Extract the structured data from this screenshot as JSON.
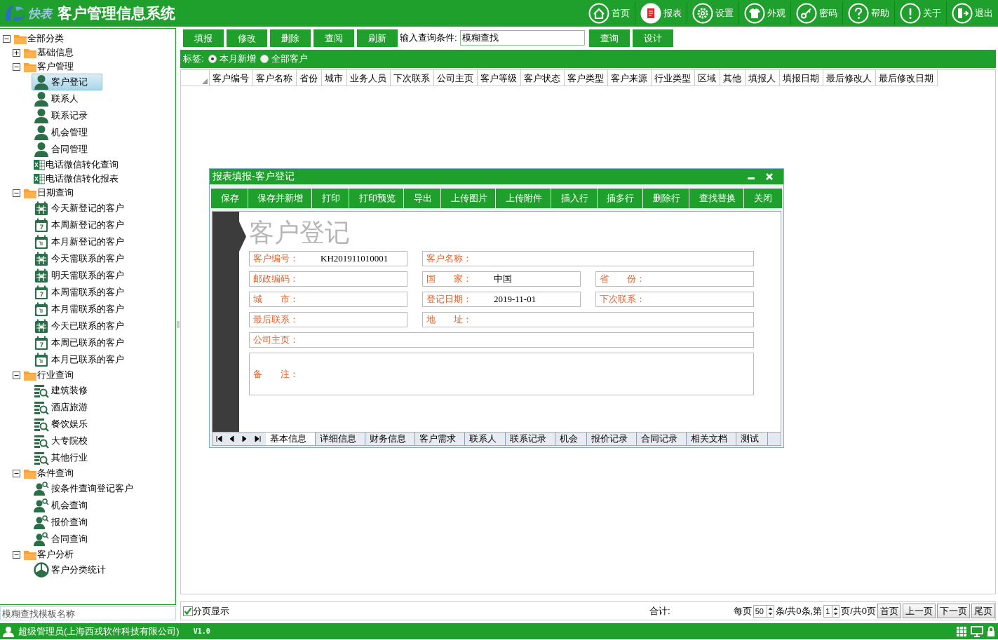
{
  "app": {
    "logo_text": "快表",
    "title": "客户管理信息系统"
  },
  "nav": [
    {
      "label": "首页",
      "selected": false
    },
    {
      "label": "报表",
      "selected": true
    },
    {
      "label": "设置",
      "selected": false
    },
    {
      "label": "外观",
      "selected": false
    },
    {
      "label": "密码",
      "selected": false
    },
    {
      "label": "帮助",
      "selected": false
    },
    {
      "label": "关于",
      "selected": false
    },
    {
      "label": "退出",
      "selected": false
    }
  ],
  "tree": [
    {
      "label": "全部分类",
      "kind": "folder",
      "expanded": true,
      "selected": false,
      "children": [
        {
          "label": "基础信息",
          "kind": "folder",
          "expanded": false,
          "selected": false
        },
        {
          "label": "客户管理",
          "kind": "folder",
          "expanded": true,
          "selected": false,
          "children": [
            {
              "label": "客户登记",
              "kind": "person",
              "selected": true
            },
            {
              "label": "联系人",
              "kind": "person",
              "selected": false
            },
            {
              "label": "联系记录",
              "kind": "person",
              "selected": false
            },
            {
              "label": "机会管理",
              "kind": "person",
              "selected": false
            },
            {
              "label": "合同管理",
              "kind": "person",
              "selected": false
            },
            {
              "label": "电话微信转化查询",
              "kind": "sheet",
              "selected": false
            },
            {
              "label": "电话微信转化报表",
              "kind": "sheet",
              "selected": false
            }
          ]
        },
        {
          "label": "日期查询",
          "kind": "folder",
          "expanded": true,
          "selected": false,
          "children": [
            {
              "label": "今天新登记的客户",
              "kind": "day",
              "selected": false
            },
            {
              "label": "本周新登记的客户",
              "kind": "week",
              "selected": false
            },
            {
              "label": "本月新登记的客户",
              "kind": "month",
              "selected": false
            },
            {
              "label": "今天需联系的客户",
              "kind": "day",
              "selected": false
            },
            {
              "label": "明天需联系的客户",
              "kind": "day",
              "selected": false
            },
            {
              "label": "本周需联系的客户",
              "kind": "week",
              "selected": false
            },
            {
              "label": "本月需联系的客户",
              "kind": "month",
              "selected": false
            },
            {
              "label": "今天已联系的客户",
              "kind": "day",
              "selected": false
            },
            {
              "label": "本周已联系的客户",
              "kind": "week",
              "selected": false
            },
            {
              "label": "本月已联系的客户",
              "kind": "month",
              "selected": false
            }
          ]
        },
        {
          "label": "行业查询",
          "kind": "folder",
          "expanded": true,
          "selected": false,
          "children": [
            {
              "label": "建筑装修",
              "kind": "industry",
              "selected": false
            },
            {
              "label": "酒店旅游",
              "kind": "industry",
              "selected": false
            },
            {
              "label": "餐饮娱乐",
              "kind": "industry",
              "selected": false
            },
            {
              "label": "大专院校",
              "kind": "industry",
              "selected": false
            },
            {
              "label": "其他行业",
              "kind": "industry",
              "selected": false
            }
          ]
        },
        {
          "label": "条件查询",
          "kind": "folder",
          "expanded": true,
          "selected": false,
          "children": [
            {
              "label": "按条件查询登记客户",
              "kind": "query",
              "selected": false
            },
            {
              "label": "机会查询",
              "kind": "query",
              "selected": false
            },
            {
              "label": "报价查询",
              "kind": "query",
              "selected": false
            },
            {
              "label": "合同查询",
              "kind": "query",
              "selected": false
            }
          ]
        },
        {
          "label": "客户分析",
          "kind": "folder",
          "expanded": true,
          "selected": false,
          "children": [
            {
              "label": "客户分类统计",
              "kind": "chart",
              "selected": false
            }
          ]
        }
      ]
    }
  ],
  "template_search": {
    "placeholder": "模糊查找模板名称"
  },
  "toolbar": {
    "buttons_left": [
      "填报",
      "修改",
      "删除",
      "查阅",
      "刷新"
    ],
    "query_label": "输入查询条件:",
    "query_value": "模糊查找",
    "buttons_right": [
      "查询",
      "设计"
    ]
  },
  "filter": {
    "label": "标签:",
    "options": [
      {
        "label": "本月新增",
        "selected": true
      },
      {
        "label": "全部客户",
        "selected": false
      }
    ]
  },
  "table": {
    "columns": [
      "客户编号",
      "客户名称",
      "省份",
      "城市",
      "业务人员",
      "下次联系",
      "公司主页",
      "客户等级",
      "客户状态",
      "客户类型",
      "客户来源",
      "行业类型",
      "区域",
      "其他",
      "填报人",
      "填报日期",
      "最后修改人",
      "最后修改日期"
    ]
  },
  "dialog": {
    "title": "报表填报-客户登记",
    "buttons": [
      "保存",
      "保存并新增",
      "打印",
      "打印预览",
      "导出",
      "上传图片",
      "上传附件",
      "插入行",
      "插多行",
      "删除行",
      "查找替换",
      "关闭"
    ],
    "form_title": "客户登记",
    "fields": [
      {
        "label": "客户编号：",
        "value": "KH201911010001",
        "kind": "short"
      },
      {
        "label": "客户名称：",
        "kind": "wide"
      },
      {
        "label": "邮政编码：",
        "kind": "short"
      },
      {
        "label": "国　　家：",
        "value": "中国",
        "kind": "short"
      },
      {
        "label": "省　　份：",
        "kind": "short"
      },
      {
        "label": "城　　市：",
        "kind": "short"
      },
      {
        "label": "登记日期：",
        "value": "2019-11-01",
        "kind": "short"
      },
      {
        "label": "下次联系：",
        "kind": "short"
      },
      {
        "label": "最后联系：",
        "kind": "short"
      },
      {
        "label": "地　　址：",
        "kind": "wide"
      },
      {
        "label": "公司主页：",
        "kind": "full"
      },
      {
        "label": "备　　注：",
        "kind": "memo"
      }
    ],
    "tabs": [
      {
        "label": "基本信息",
        "selected": true
      },
      {
        "label": "详细信息",
        "selected": false
      },
      {
        "label": "财务信息",
        "selected": false
      },
      {
        "label": "客户需求",
        "selected": false
      },
      {
        "label": "联系人",
        "selected": false
      },
      {
        "label": "联系记录",
        "selected": false
      },
      {
        "label": "机会",
        "selected": false
      },
      {
        "label": "报价记录",
        "selected": false
      },
      {
        "label": "合同记录",
        "selected": false
      },
      {
        "label": "相关文档",
        "selected": false
      },
      {
        "label": "测试",
        "selected": false
      }
    ]
  },
  "footer": {
    "paging": {
      "label": "分页显示",
      "checked": true
    },
    "total_label": "合计:",
    "per_page_label": "每页",
    "page_size": "50",
    "count_text": "条/共0条,第",
    "page": "1",
    "pages_text": "页/共0页",
    "buttons": [
      "首页",
      "上一页",
      "下一页",
      "尾页"
    ]
  },
  "status": {
    "user": "超级管理员(上海西戎软件科技有限公司)",
    "version": "V1.0"
  }
}
